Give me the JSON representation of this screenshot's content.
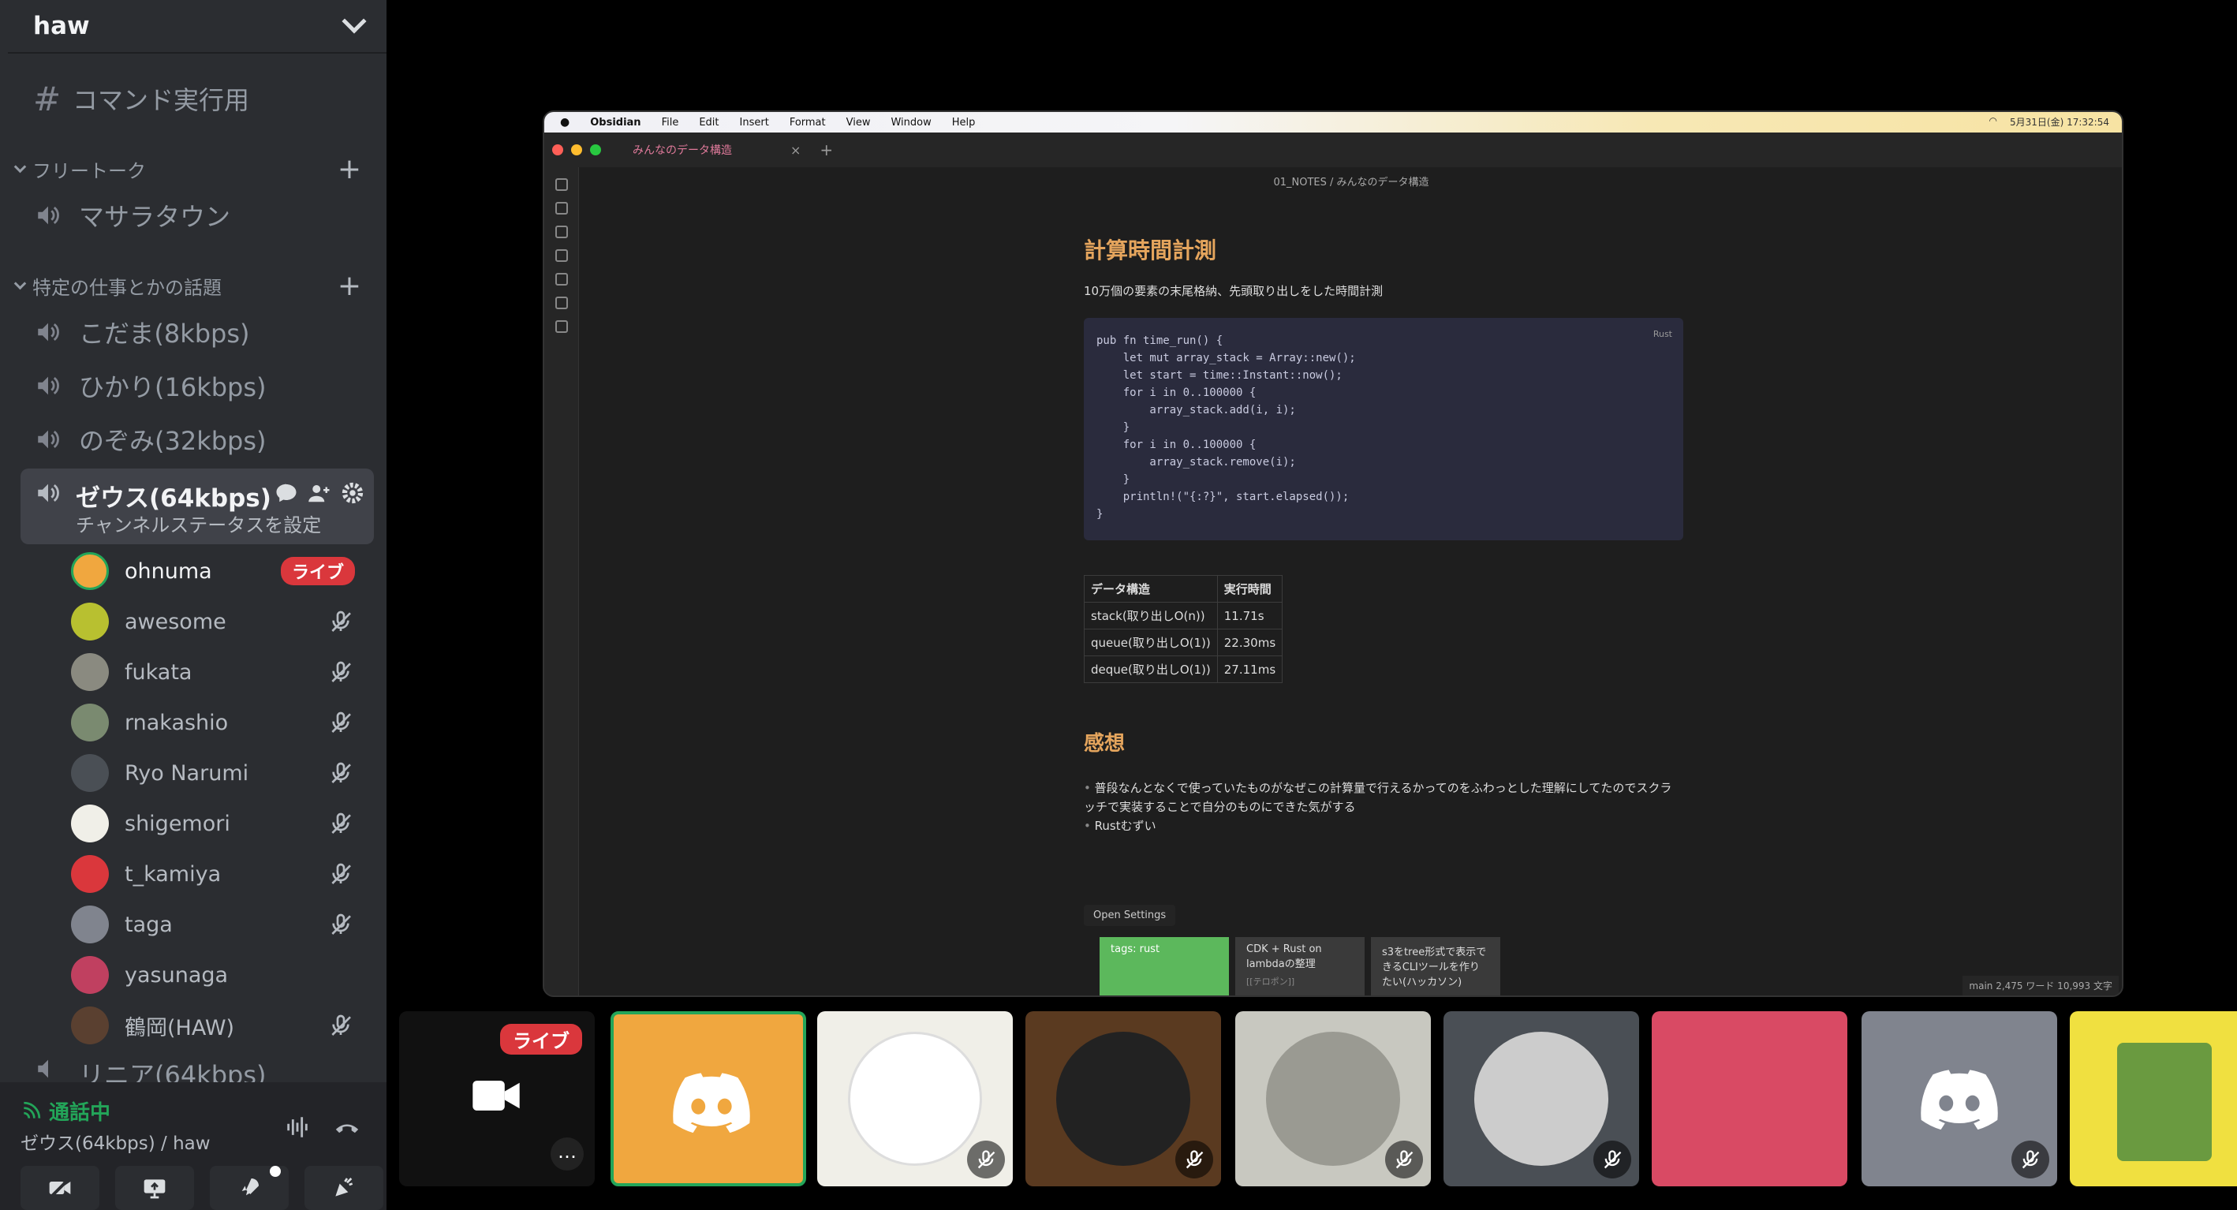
{
  "server": {
    "name": "haw"
  },
  "channels": {
    "command": "コマンド実行用",
    "categories": [
      {
        "name": "フリートーク",
        "channels": [
          "マサラタウン"
        ]
      },
      {
        "name": "特定の仕事とかの話題",
        "channels": [
          "こだま(8kbps)",
          "ひかり(16kbps)",
          "のぞみ(32kbps)"
        ]
      }
    ],
    "active": {
      "name": "ゼウス(64kbps)",
      "status": "チャンネルステータスを設定"
    },
    "next_partial": "リニア(64kbps)"
  },
  "members": [
    {
      "name": "ohnuma",
      "badge": "ライブ",
      "color": "#f0a73f"
    },
    {
      "name": "awesome",
      "color": "#b8c030"
    },
    {
      "name": "fukata",
      "color": "#8a8a80"
    },
    {
      "name": "rnakashio",
      "color": "#7a8a70"
    },
    {
      "name": "Ryo Narumi",
      "color": "#4a4f55"
    },
    {
      "name": "shigemori",
      "color": "#f0efe8"
    },
    {
      "name": "t_kamiya",
      "color": "#da373c"
    },
    {
      "name": "taga",
      "color": "#80848e"
    },
    {
      "name": "yasunaga",
      "color": "#c04060"
    },
    {
      "name": "鶴岡(HAW)",
      "color": "#5a4030"
    }
  ],
  "voice": {
    "status": "通話中",
    "channel": "ゼウス(64kbps) / haw"
  },
  "colors": {
    "live": "#da373c",
    "green": "#23a559",
    "sidebar": "#2b2d31"
  },
  "obsidian": {
    "menubar": [
      "Obsidian",
      "File",
      "Edit",
      "Insert",
      "Format",
      "View",
      "Window",
      "Help"
    ],
    "datetime": "5月31日(金) 17:32:54",
    "tab": "みんなのデータ構造",
    "breadcrumb": "01_NOTES / みんなのデータ構造",
    "h1": "計算時間計測",
    "desc": "10万個の要素の末尾格納、先頭取り出しをした時間計測",
    "code_lang": "Rust",
    "code_lines": [
      "pub fn time_run() {",
      "    let mut array_stack = Array::new();",
      "    let start = time::Instant::now();",
      "    for i in 0..100000 {",
      "        array_stack.add(i, i);",
      "    }",
      "    for i in 0..100000 {",
      "        array_stack.remove(i);",
      "    }",
      "    println!(\"{:?}\", start.elapsed());",
      "}"
    ],
    "table": {
      "headers": [
        "データ構造",
        "実行時間"
      ],
      "rows": [
        [
          "stack(取り出しO(n))",
          "11.71s"
        ],
        [
          "queue(取り出しO(1))",
          "22.30ms"
        ],
        [
          "deque(取り出しO(1))",
          "27.11ms"
        ]
      ]
    },
    "h2": "感想",
    "impressions": [
      "普段なんとなくで使っていたものがなぜこの計算量で行えるかってのをふわっとした理解にしてたのでスクラッチで実装することで自分のものにできた気がする",
      "Rustむずい"
    ],
    "open_settings": "Open Settings",
    "cards": [
      "tags: rust",
      "CDK + Rust on lambdaの整理",
      "s3をtree形式で表示できるCLIツールを作りたい(ハッカソン)"
    ],
    "card_sub": "[[テロポン]]",
    "status": "main  2,475 ワード  10,993 文字"
  },
  "tiles": {
    "live_badge": "ライブ",
    "more": "…",
    "colors": [
      "#f0a73f",
      "#f0efe8",
      "#5a3a20",
      "#c8c8c0",
      "#4a4f55",
      "#d94a64",
      "#80848e",
      "#f0e040"
    ]
  }
}
